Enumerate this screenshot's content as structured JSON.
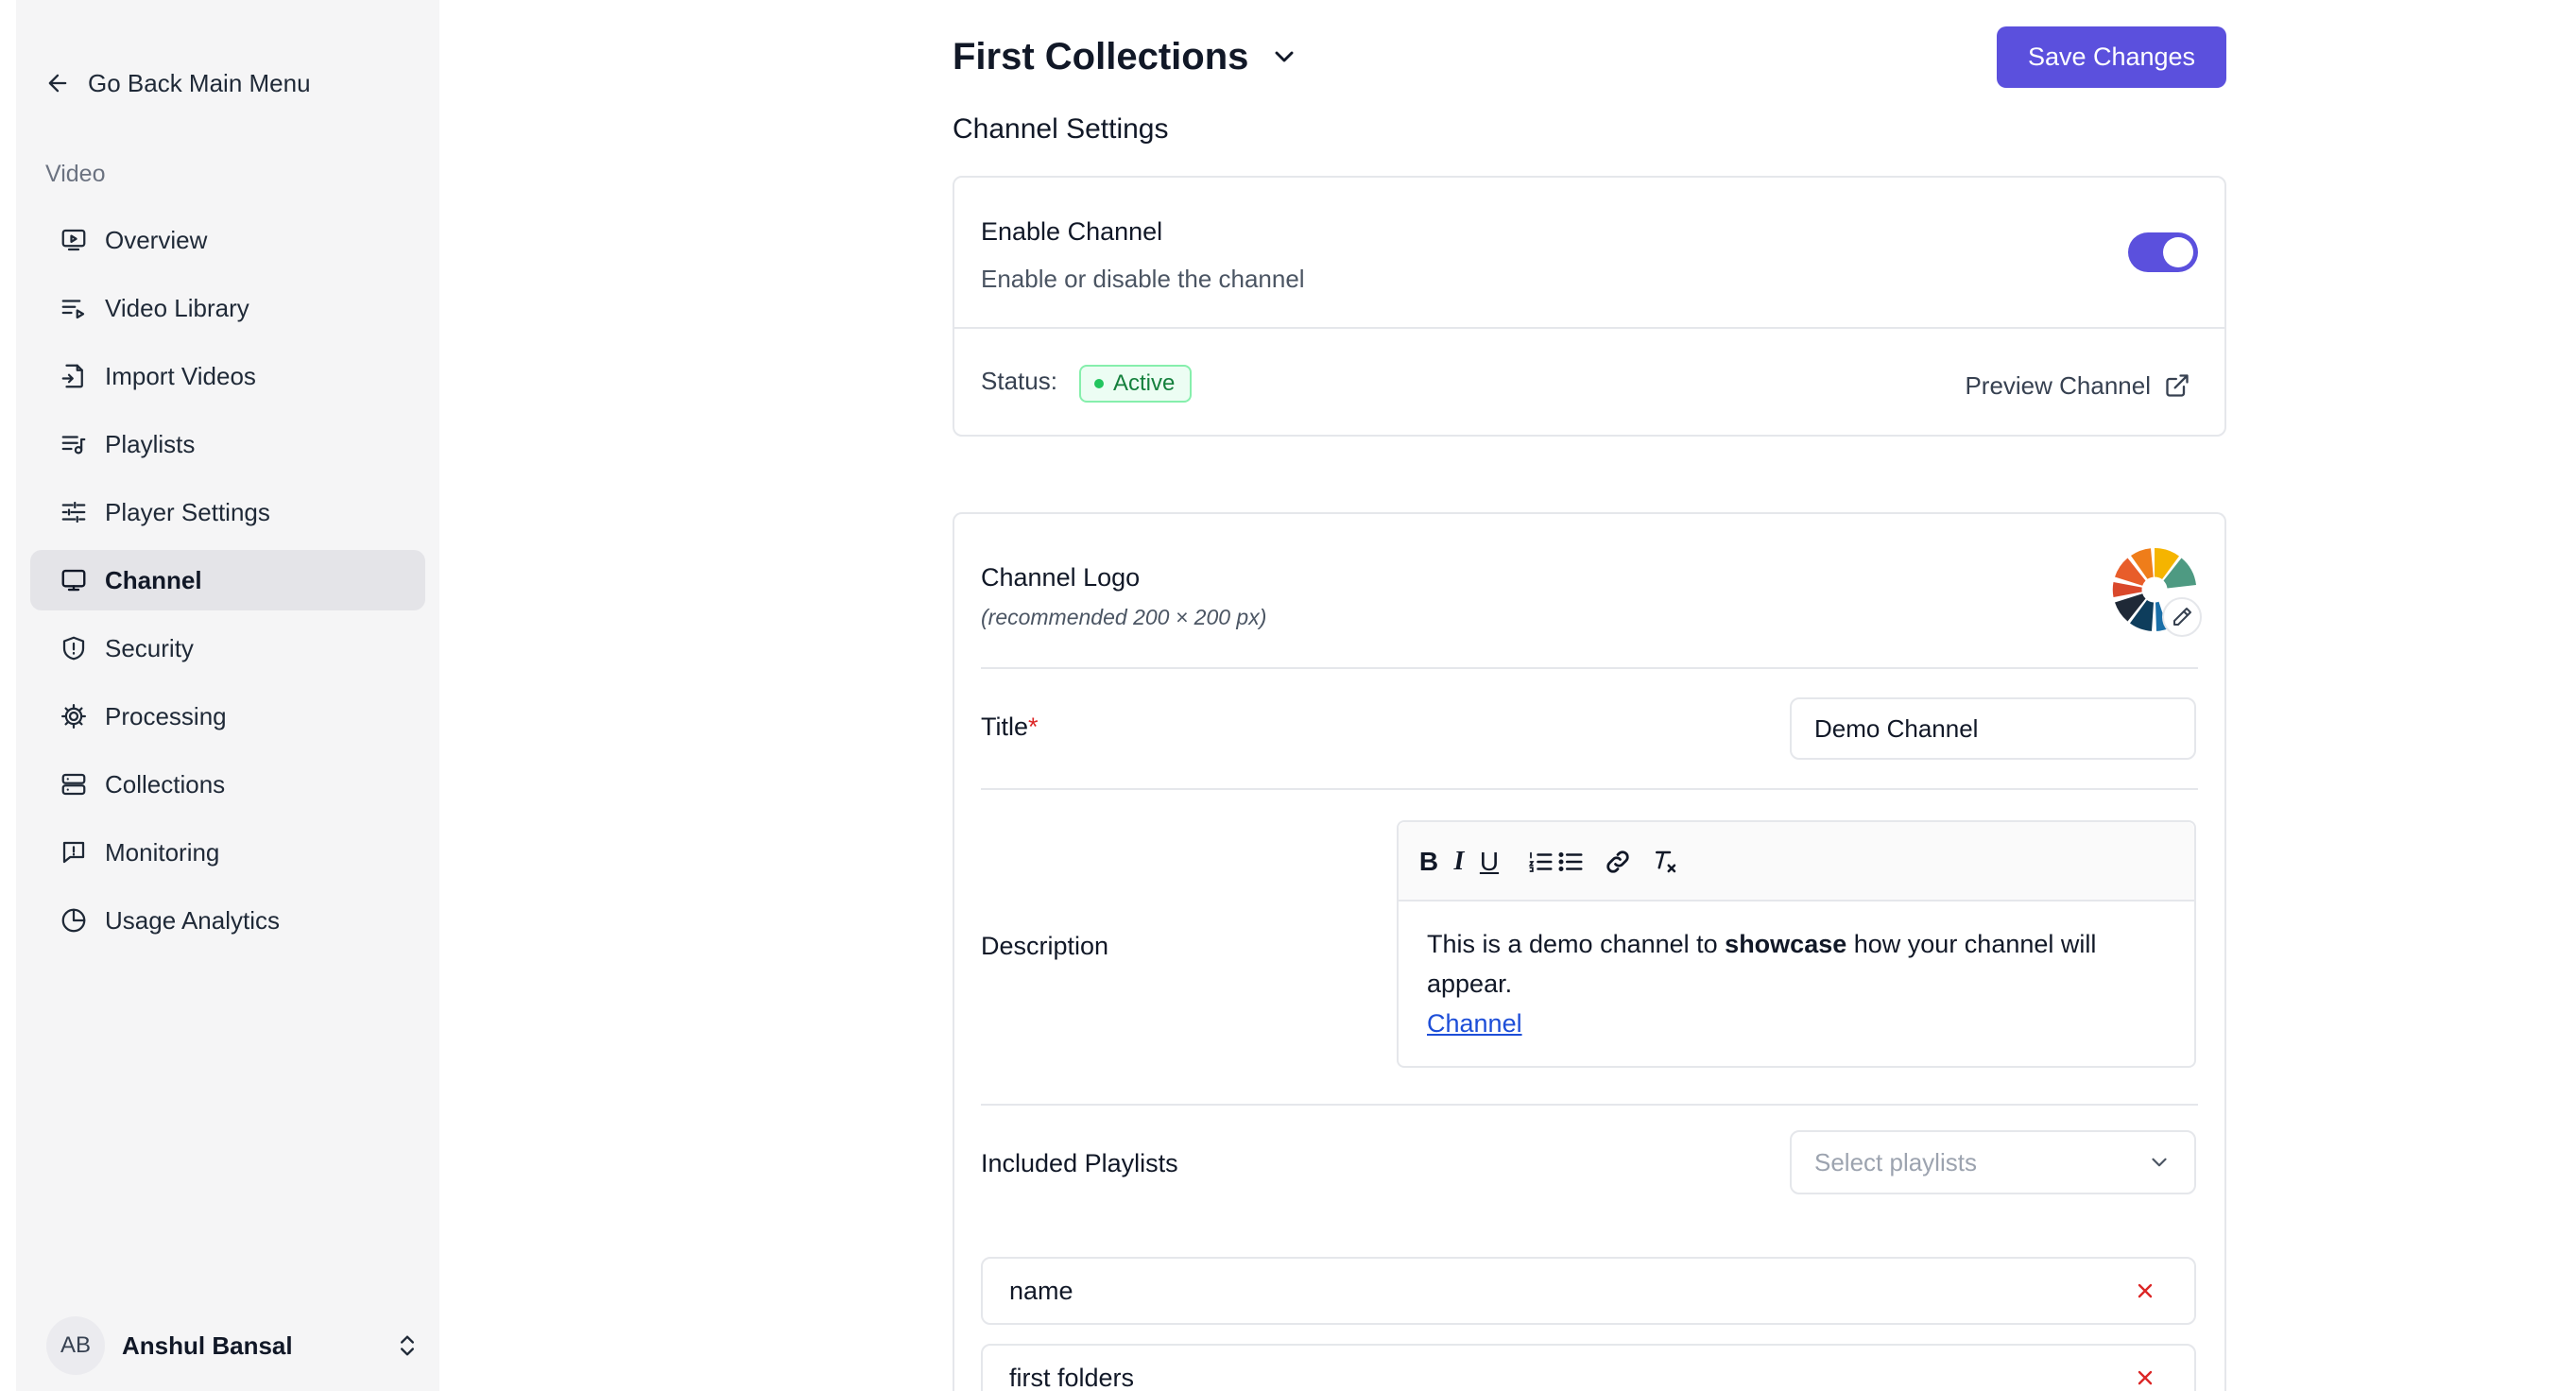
{
  "sidebar": {
    "back_label": "Go Back Main Menu",
    "section_label": "Video",
    "items": [
      {
        "label": "Overview"
      },
      {
        "label": "Video Library"
      },
      {
        "label": "Import Videos"
      },
      {
        "label": "Playlists"
      },
      {
        "label": "Player Settings"
      },
      {
        "label": "Channel"
      },
      {
        "label": "Security"
      },
      {
        "label": "Processing"
      },
      {
        "label": "Collections"
      },
      {
        "label": "Monitoring"
      },
      {
        "label": "Usage Analytics"
      }
    ],
    "active_item": "Channel",
    "user": {
      "initials": "AB",
      "name": "Anshul Bansal"
    }
  },
  "header": {
    "title": "First Collections",
    "save_label": "Save Changes",
    "accent_color": "#5b50dd"
  },
  "channel_settings": {
    "title": "Channel Settings",
    "enable_label": "Enable Channel",
    "enable_desc": "Enable or disable the channel",
    "enabled": true,
    "status_label": "Status:",
    "status_value": "Active",
    "preview_label": "Preview Channel"
  },
  "form": {
    "logo_label": "Channel Logo",
    "logo_hint": "(recommended 200 × 200 px)",
    "title_label": "Title",
    "required_mark": "*",
    "title_value": "Demo Channel",
    "description_label": "Description",
    "description": {
      "text_before": "This is a demo channel to ",
      "bold": "showcase",
      "text_after": " how your channel will appear.",
      "link": "Channel"
    },
    "toolbar": {
      "bold": "B",
      "italic": "I",
      "underline": "U"
    },
    "playlists_label": "Included Playlists",
    "playlists_placeholder": "Select playlists",
    "selected_playlists": [
      "name",
      "first folders"
    ]
  }
}
